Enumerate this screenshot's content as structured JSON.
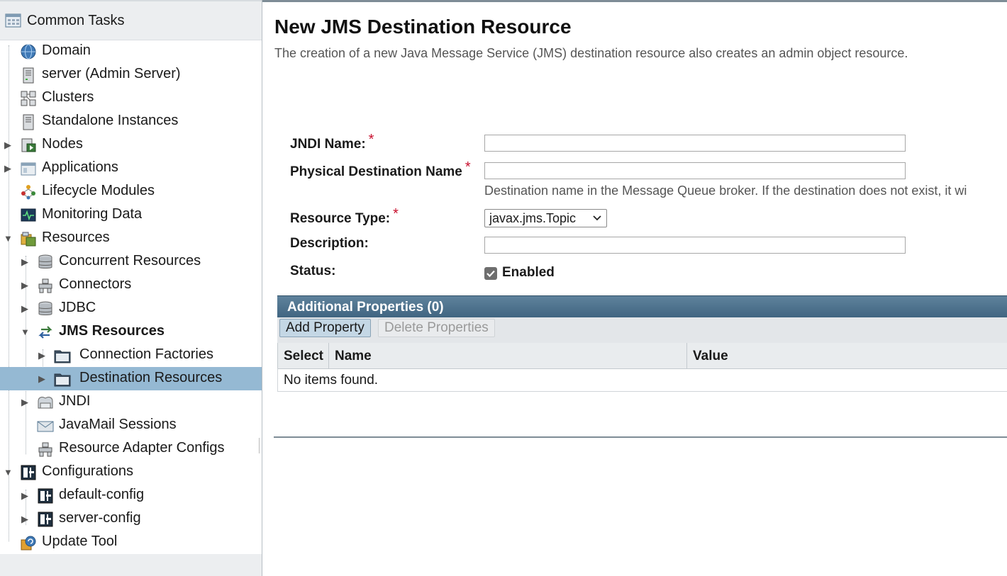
{
  "sidebar": {
    "header_label": "Common Tasks",
    "items": [
      {
        "label": "Domain",
        "icon": "domain-globe-icon"
      },
      {
        "label": "server (Admin Server)",
        "icon": "server-icon"
      },
      {
        "label": "Clusters",
        "icon": "clusters-icon"
      },
      {
        "label": "Standalone Instances",
        "icon": "server-icon"
      },
      {
        "label": "Nodes",
        "icon": "nodes-icon",
        "collapsed": true
      },
      {
        "label": "Applications",
        "icon": "applications-icon",
        "collapsed": true
      },
      {
        "label": "Lifecycle Modules",
        "icon": "lifecycle-icon"
      },
      {
        "label": "Monitoring Data",
        "icon": "monitoring-icon"
      },
      {
        "label": "Resources",
        "icon": "resources-icon",
        "expanded": true
      },
      {
        "label": "Concurrent Resources",
        "icon": "database-icon",
        "collapsed": true
      },
      {
        "label": "Connectors",
        "icon": "connector-icon",
        "collapsed": true
      },
      {
        "label": "JDBC",
        "icon": "database-icon",
        "collapsed": true
      },
      {
        "label": "JMS Resources",
        "icon": "jms-arrows-icon",
        "expanded": true
      },
      {
        "label": "Connection Factories",
        "icon": "folder-icon",
        "collapsed": true
      },
      {
        "label": "Destination Resources",
        "icon": "folder-icon",
        "collapsed": true,
        "selected": true
      },
      {
        "label": "JNDI",
        "icon": "jndi-icon",
        "collapsed": true
      },
      {
        "label": "JavaMail Sessions",
        "icon": "mail-icon"
      },
      {
        "label": "Resource Adapter Configs",
        "icon": "connector-icon"
      },
      {
        "label": "Configurations",
        "icon": "config-icon",
        "expanded": true
      },
      {
        "label": "default-config",
        "icon": "config-icon",
        "collapsed": true
      },
      {
        "label": "server-config",
        "icon": "config-icon",
        "collapsed": true
      },
      {
        "label": "Update Tool",
        "icon": "update-tool-icon"
      }
    ]
  },
  "main": {
    "title": "New JMS Destination Resource",
    "description": "The creation of a new Java Message Service (JMS) destination resource also creates an admin object resource.",
    "form": {
      "jndi_name_label": "JNDI Name:",
      "jndi_name_value": "",
      "physical_dest_label": "Physical Destination Name",
      "physical_dest_value": "",
      "physical_dest_help": "Destination name in the Message Queue broker. If the destination does not exist, it wi",
      "resource_type_label": "Resource Type:",
      "resource_type_value": "javax.jms.Topic",
      "description_label": "Description:",
      "description_value": "",
      "status_label": "Status:",
      "status_enabled_label": "Enabled",
      "status_enabled": true,
      "required_marker": "*"
    },
    "additional_properties": {
      "title": "Additional Properties (0)",
      "add_button": "Add Property",
      "delete_button": "Delete Properties",
      "columns": [
        "Select",
        "Name",
        "Value"
      ],
      "empty_text": "No items found."
    }
  },
  "colors": {
    "selected_row": "#95b9d3",
    "table_header": "#4a6e8a",
    "required": "#c8102e"
  }
}
